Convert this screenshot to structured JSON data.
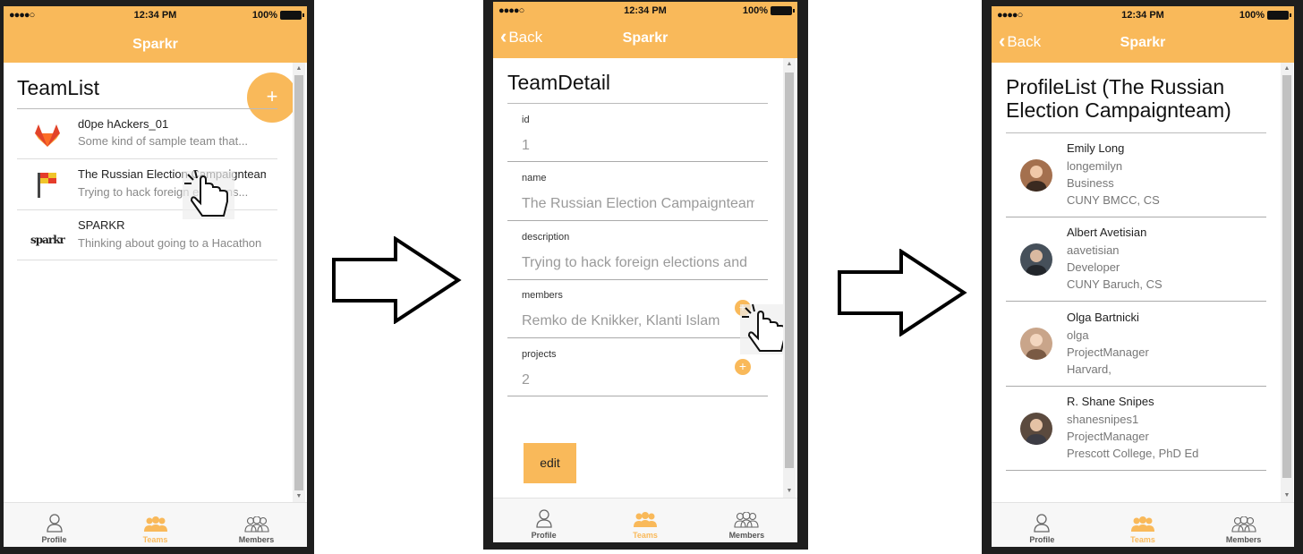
{
  "status": {
    "carrier": "●●●●○",
    "time": "12:34 PM",
    "battery": "100%"
  },
  "app": {
    "title": "Sparkr",
    "back_label": "Back"
  },
  "tabs": [
    {
      "label": "Profile",
      "icon": "person-icon"
    },
    {
      "label": "Teams",
      "icon": "team-icon"
    },
    {
      "label": "Members",
      "icon": "members-icon"
    }
  ],
  "teamlist": {
    "title": "TeamList",
    "add_symbol": "+",
    "teams": [
      {
        "name": "d0pe hAckers_01",
        "desc": "Some kind of sample team that...",
        "logo": "gitlab-fox-logo"
      },
      {
        "name": "The Russian Election Campaignteam",
        "desc": "Trying to hack foreign elections...",
        "logo": "flag-logo"
      },
      {
        "name": "SPARKR",
        "desc": "Thinking about going to a Hacathon",
        "logo": "sparkr-logo"
      }
    ]
  },
  "teamdetail": {
    "title": "TeamDetail",
    "fields": [
      {
        "label": "id",
        "value": "1"
      },
      {
        "label": "name",
        "value": "The Russian Election Campaignteam"
      },
      {
        "label": "description",
        "value": "Trying to hack foreign elections and"
      },
      {
        "label": "members",
        "value": "Remko de Knikker, Klanti Islam"
      },
      {
        "label": "projects",
        "value": "2"
      }
    ],
    "add_symbol": "+",
    "edit_label": "edit"
  },
  "profilelist": {
    "title": "ProfileList (The Russian Election Campaignteam)",
    "profiles": [
      {
        "name": "Emily Long",
        "username": "longemilyn",
        "role": "Business",
        "school": "CUNY BMCC, CS",
        "avatar_color": "#a4704e"
      },
      {
        "name": "Albert Avetisian",
        "username": "aavetisian",
        "role": "Developer",
        "school": "CUNY Baruch, CS",
        "avatar_color": "#46505a"
      },
      {
        "name": "Olga Bartnicki",
        "username": "olga",
        "role": "ProjectManager",
        "school": "Harvard,",
        "avatar_color": "#c9a58a"
      },
      {
        "name": "R. Shane Snipes",
        "username": "shanesnipes1",
        "role": "ProjectManager",
        "school": "Prescott College, PhD Ed",
        "avatar_color": "#5b4a3e"
      }
    ]
  },
  "colors": {
    "accent": "#f9b95a",
    "phone_frame": "#1e1e1e"
  }
}
